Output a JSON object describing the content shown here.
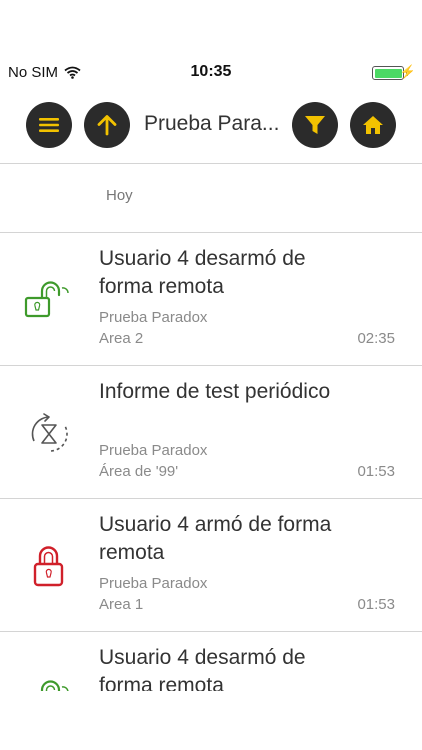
{
  "status_bar": {
    "carrier": "No SIM",
    "time": "10:35",
    "colors": {
      "battery": "#4cd964"
    }
  },
  "nav": {
    "title": "Prueba Para...",
    "menu_icon": "hamburger-menu-icon",
    "up_icon": "arrow-up-icon",
    "filter_icon": "filter-funnel-icon",
    "home_icon": "home-icon",
    "colors": {
      "button_bg": "#2b2b2b",
      "icon": "#f2c200"
    }
  },
  "section": {
    "label": "Hoy"
  },
  "events": [
    {
      "title": "Usuario 4 desarmó de forma remota",
      "site": "Prueba Paradox",
      "area": "Area 2",
      "time": "02:35",
      "icon": "unlocked-padlock-icon",
      "color": "#3e9a2b"
    },
    {
      "title": "Informe de test periódico",
      "site": "Prueba Paradox",
      "area": "Área de '99'",
      "time": "01:53",
      "icon": "hourglass-refresh-icon",
      "color": "#555555"
    },
    {
      "title": "Usuario 4 armó de forma remota",
      "site": "Prueba Paradox",
      "area": "Area 1",
      "time": "01:53",
      "icon": "locked-padlock-icon",
      "color": "#d0202a"
    },
    {
      "title": "Usuario 4 desarmó de forma remota",
      "site": "",
      "area": "",
      "time": "",
      "icon": "unlocked-padlock-icon",
      "color": "#3e9a2b"
    }
  ]
}
